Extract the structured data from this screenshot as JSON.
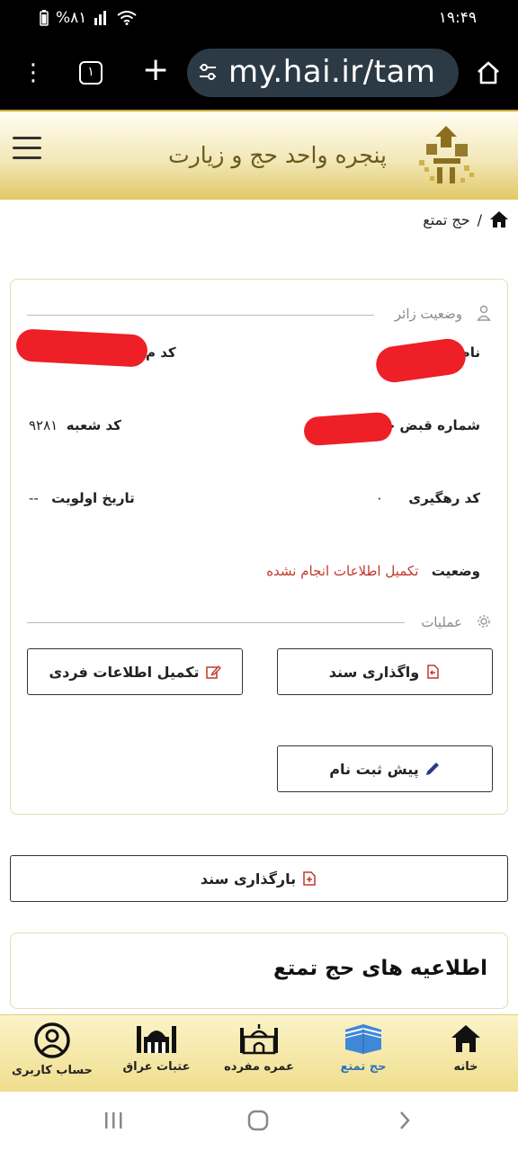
{
  "status_bar": {
    "time": "۱۹:۴۹",
    "battery": "%۸۱",
    "icons": [
      "battery-icon",
      "signal-icon",
      "wifi-icon"
    ]
  },
  "browser": {
    "tab_count": "۱",
    "url": "my.hai.ir/tam",
    "icons": [
      "menu-dots-icon",
      "tabs-icon",
      "plus-icon",
      "site-settings-icon",
      "home-icon"
    ]
  },
  "header": {
    "title": "پنجره واحد حج و زیارت"
  },
  "breadcrumb": {
    "separator": "/",
    "current": "حج تمتع"
  },
  "pilgrim_status": {
    "section_title": "وضعیت زائر",
    "fields": {
      "name_label": "نام",
      "code_label": "کد م",
      "receipt_label": "شماره قبض حج",
      "branch_label": "کد شعبه",
      "branch_value": "۹۲۸۱",
      "tracking_label": "کد رهگیری",
      "tracking_value": "۰",
      "priority_label": "تاریخ اولویت",
      "priority_value": "--",
      "status_label": "وضعیت",
      "status_value": "تکمیل اطلاعات انجام نشده"
    }
  },
  "operations": {
    "section_title": "عملیات",
    "transfer_label": "واگذاری سند",
    "complete_info_label": "تکمیل اطلاعات فردی",
    "pre_register_label": "پیش ثبت نام"
  },
  "upload_label": "بارگذاری سند",
  "announcements": {
    "title": "اطلاعیه های حج تمتع"
  },
  "bottom_nav": {
    "items": [
      {
        "label": "خانه",
        "icon": "home-icon"
      },
      {
        "label": "حج تمتع",
        "icon": "kaaba-icon"
      },
      {
        "label": "عمره مفرده",
        "icon": "mosque-icon"
      },
      {
        "label": "عتبات عراق",
        "icon": "shrine-icon"
      },
      {
        "label": "حساب کاربری",
        "icon": "user-circle-icon"
      }
    ]
  },
  "colors": {
    "status_red": "#c0392b",
    "accent_blue": "#2f73b8",
    "header_gold": "#e0c867",
    "redaction": "#ee1f26"
  }
}
